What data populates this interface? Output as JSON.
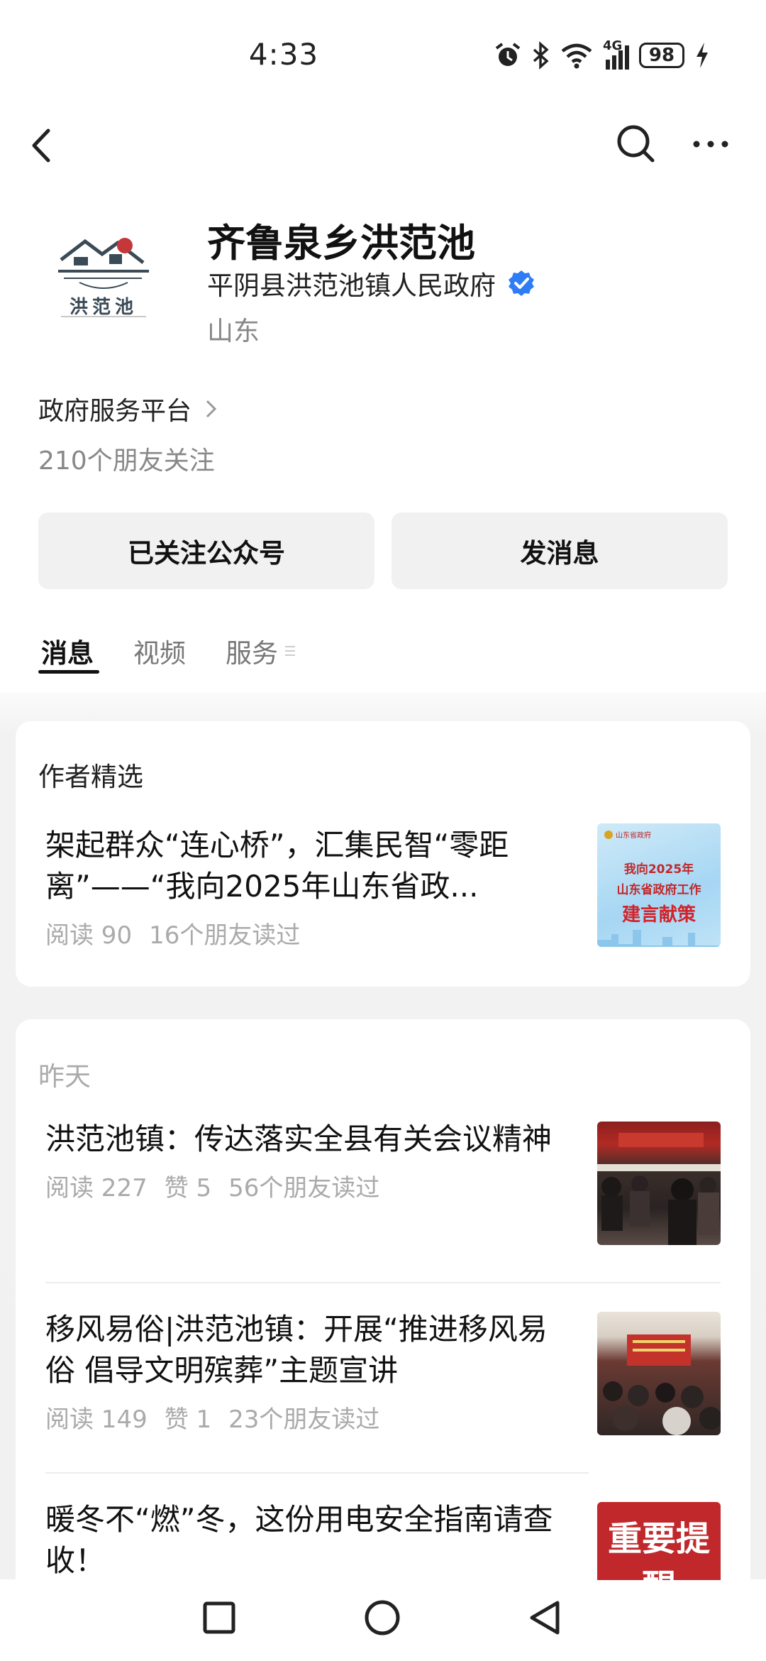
{
  "status_bar": {
    "time": "4:33",
    "network": "4G",
    "battery": "98"
  },
  "profile": {
    "name": "齐鲁泉乡洪范池",
    "organization": "平阴县洪范池镇人民政府",
    "region": "山东",
    "logo_text": "洪范池"
  },
  "service_platform": "政府服务平台",
  "friends_following": "210个朋友关注",
  "buttons": {
    "follow": "已关注公众号",
    "message": "发消息"
  },
  "tabs": [
    {
      "label": "消息"
    },
    {
      "label": "视频"
    },
    {
      "label": "服务"
    }
  ],
  "featured": {
    "header": "作者精选",
    "article": {
      "title": "架起群众“连心桥”，汇集民智“零距离”——“我向2025年山东省政...",
      "reads": "阅读 90",
      "friends": "16个朋友读过",
      "thumb_lines": [
        "我向2025年",
        "山东省政府工作",
        "建言献策"
      ],
      "thumb_logo": "山东省政府"
    }
  },
  "recent": {
    "header": "昨天",
    "articles": [
      {
        "title": "洪范池镇：传达落实全县有关会议精神",
        "reads": "阅读 227",
        "likes": "赞 5",
        "friends": "56个朋友读过"
      },
      {
        "title": "移风易俗|洪范池镇：开展“推进移风易俗 倡导文明殡葬”主题宣讲",
        "reads": "阅读 149",
        "likes": "赞 1",
        "friends": "23个朋友读过"
      },
      {
        "title": "暖冬不“燃”冬，这份用电安全指南请查收！",
        "thumb_text": "重要提醒"
      }
    ]
  },
  "colors": {
    "verified": "#2f7df6",
    "background": "#f1f1f1",
    "accent_red": "#c0282b"
  }
}
